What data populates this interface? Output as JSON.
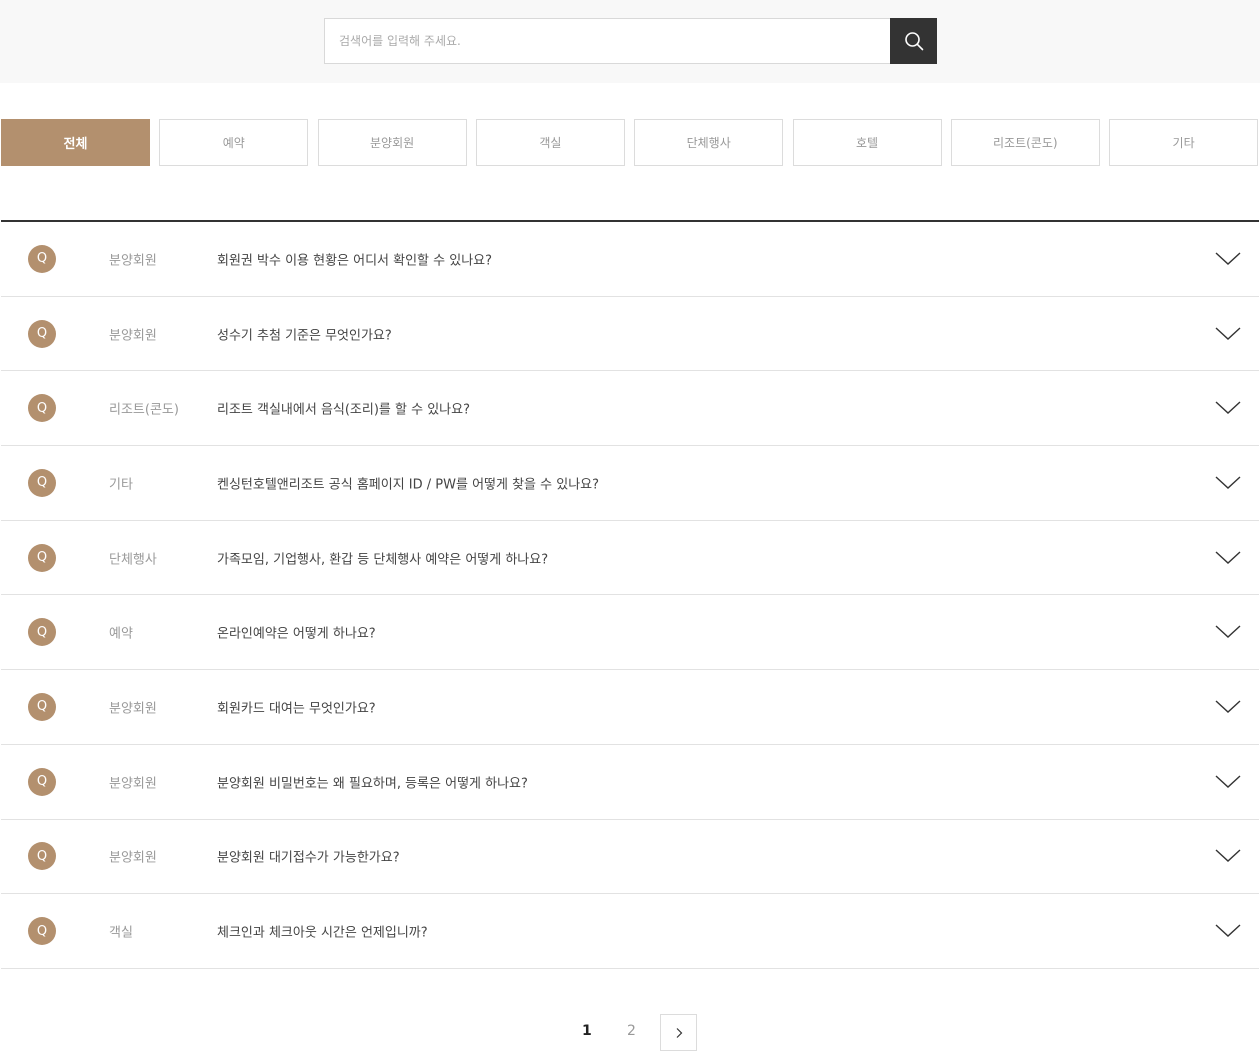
{
  "search": {
    "placeholder": "검색어를 입력해 주세요."
  },
  "tabs": [
    {
      "label": "전체",
      "active": true
    },
    {
      "label": "예약",
      "active": false
    },
    {
      "label": "분양회원",
      "active": false
    },
    {
      "label": "객실",
      "active": false
    },
    {
      "label": "단체행사",
      "active": false
    },
    {
      "label": "호텔",
      "active": false
    },
    {
      "label": "리조트(콘도)",
      "active": false
    },
    {
      "label": "기타",
      "active": false
    }
  ],
  "faq": {
    "badge": "Q",
    "items": [
      {
        "category": "분양회원",
        "question": "회원권 박수 이용 현황은 어디서 확인할 수 있나요?"
      },
      {
        "category": "분양회원",
        "question": "성수기 추첨 기준은 무엇인가요?"
      },
      {
        "category": "리조트(콘도)",
        "question": "리조트 객실내에서 음식(조리)를 할 수 있나요?"
      },
      {
        "category": "기타",
        "question": "켄싱턴호텔앤리조트 공식 홈페이지 ID / PW를 어떻게 찾을 수 있나요?"
      },
      {
        "category": "단체행사",
        "question": "가족모임, 기업행사, 환갑 등 단체행사 예약은 어떻게 하나요?"
      },
      {
        "category": "예약",
        "question": "온라인예약은 어떻게 하나요?"
      },
      {
        "category": "분양회원",
        "question": "회원카드 대여는 무엇인가요?"
      },
      {
        "category": "분양회원",
        "question": "분양회원 비밀번호는 왜 필요하며, 등록은 어떻게 하나요?"
      },
      {
        "category": "분양회원",
        "question": "분양회원 대기접수가 가능한가요?"
      },
      {
        "category": "객실",
        "question": "체크인과 체크아웃 시간은 언제입니까?"
      }
    ]
  },
  "pagination": {
    "current": "1",
    "other": "2"
  },
  "colors": {
    "accent": "#b3906e",
    "search_button": "#333333"
  }
}
